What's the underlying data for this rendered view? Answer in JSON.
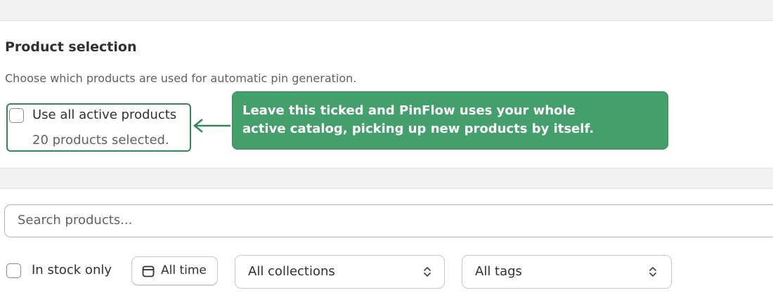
{
  "product_selection": {
    "title": "Product selection",
    "description": "Choose which products are used for automatic pin generation.",
    "use_all_label": "Use all active products",
    "use_all_checked": false,
    "selected_count_text": "20 products selected."
  },
  "callout": {
    "line1": "Leave this ticked and PinFlow uses your whole",
    "line2": "active catalog, picking up new products by itself.",
    "color": "#43a06a",
    "border_color": "#2f8a57"
  },
  "filters": {
    "search_placeholder": "Search products...",
    "in_stock_label": "In stock only",
    "in_stock_checked": false,
    "date_button_label": "All time",
    "date_button_icon": "calendar-icon",
    "collections_value": "All collections",
    "tags_value": "All tags",
    "select_icon": "chevron-up-down-icon"
  }
}
